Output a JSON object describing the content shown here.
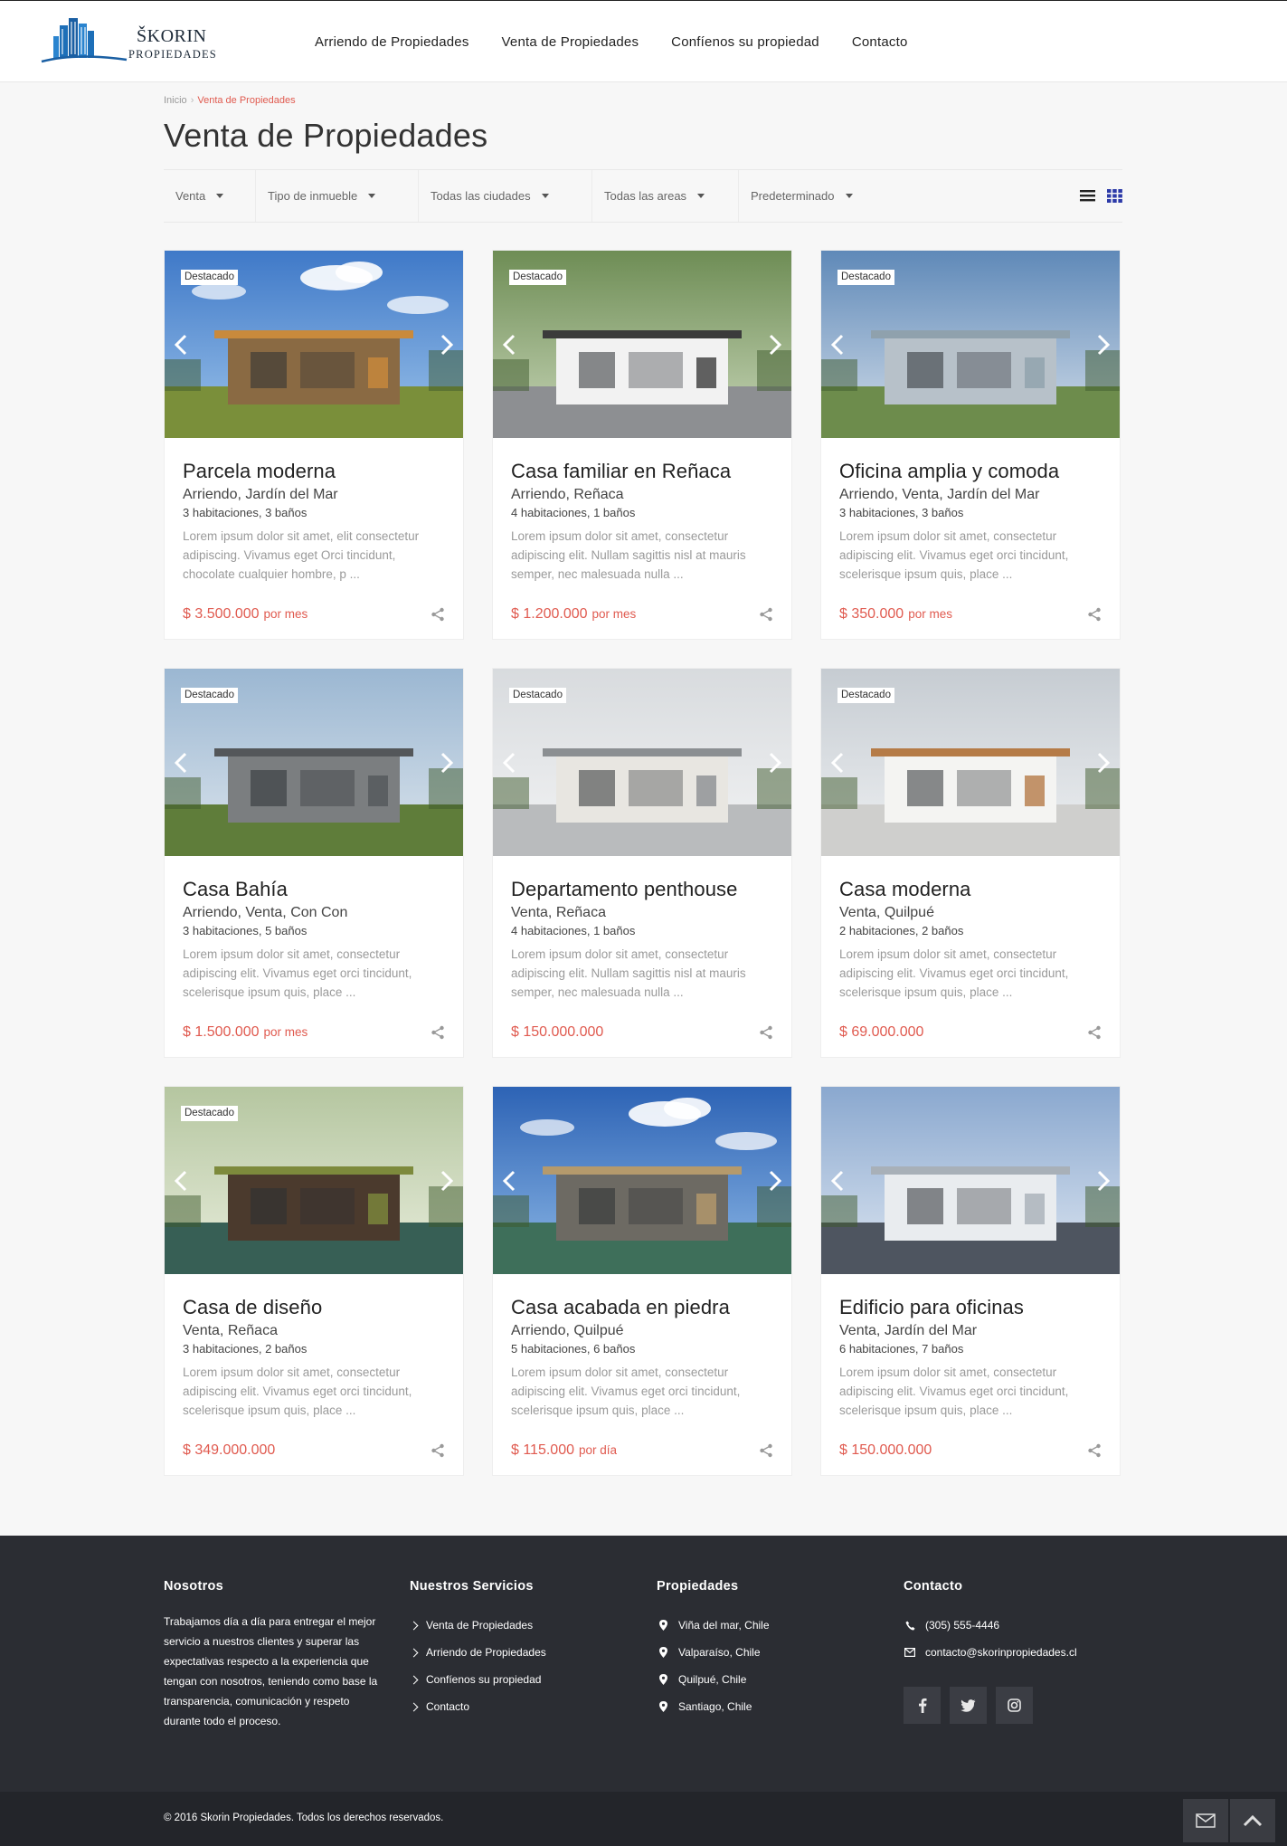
{
  "header": {
    "logo_name": "ŠKORIN",
    "logo_sub": "PROPIEDADES",
    "nav": [
      "Arriendo de Propiedades",
      "Venta de Propiedades",
      "Confíenos su propiedad",
      "Contacto"
    ]
  },
  "breadcrumb": {
    "home": "Inicio",
    "separator": "›",
    "current": "Venta de Propiedades"
  },
  "page_title": "Venta de Propiedades",
  "filters": {
    "status": "Venta",
    "type": "Tipo de inmueble",
    "city": "Todas las ciudades",
    "area": "Todas las areas",
    "sort": "Predeterminado"
  },
  "view_icons": [
    "list-view-icon",
    "grid-view-icon"
  ],
  "colors": {
    "accent": "#e05a4f",
    "footer": "#2b2d33",
    "logo": "#1d6fb8",
    "grid_icon": "#2c3aa8"
  },
  "featured_label": "Destacado",
  "properties": [
    {
      "title": "Parcela moderna",
      "location": "Arriendo, Jardín del Mar",
      "rooms": "3 habitaciones, 3 baños",
      "desc": "Lorem ipsum dolor sit amet, elit consectetur adipiscing. Vivamus eget Orci tincidunt, chocolate cualquier hombre, p ...",
      "price": "$ 3.500.000",
      "per": "por mes",
      "featured": true
    },
    {
      "title": "Casa familiar en Reñaca",
      "location": "Arriendo, Reñaca",
      "rooms": "4 habitaciones, 1 baños",
      "desc": "Lorem ipsum dolor sit amet, consectetur adipiscing elit. Nullam sagittis nisl at mauris semper, nec malesuada nulla ...",
      "price": "$ 1.200.000",
      "per": "por mes",
      "featured": true
    },
    {
      "title": "Oficina amplia y comoda",
      "location": "Arriendo, Venta, Jardín del Mar",
      "rooms": "3 habitaciones, 3 baños",
      "desc": "Lorem ipsum dolor sit amet, consectetur adipiscing elit. Vivamus eget orci tincidunt, scelerisque ipsum quis, place ...",
      "price": "$ 350.000",
      "per": "por mes",
      "featured": true
    },
    {
      "title": "Casa Bahía",
      "location": "Arriendo, Venta, Con Con",
      "rooms": "3 habitaciones, 5 baños",
      "desc": "Lorem ipsum dolor sit amet, consectetur adipiscing elit. Vivamus eget orci tincidunt, scelerisque ipsum quis, place ...",
      "price": "$ 1.500.000",
      "per": "por mes",
      "featured": true
    },
    {
      "title": "Departamento penthouse",
      "location": "Venta, Reñaca",
      "rooms": "4 habitaciones, 1 baños",
      "desc": "Lorem ipsum dolor sit amet, consectetur adipiscing elit. Nullam sagittis nisl at mauris semper, nec malesuada nulla ...",
      "price": "$ 150.000.000",
      "per": "",
      "featured": true
    },
    {
      "title": "Casa moderna",
      "location": "Venta, Quilpué",
      "rooms": "2 habitaciones, 2 baños",
      "desc": "Lorem ipsum dolor sit amet, consectetur adipiscing elit. Vivamus eget orci tincidunt, scelerisque ipsum quis, place ...",
      "price": "$ 69.000.000",
      "per": "",
      "featured": true
    },
    {
      "title": "Casa de diseño",
      "location": "Venta, Reñaca",
      "rooms": "3 habitaciones, 2 baños",
      "desc": "Lorem ipsum dolor sit amet, consectetur adipiscing elit. Vivamus eget orci tincidunt, scelerisque ipsum quis, place ...",
      "price": "$ 349.000.000",
      "per": "",
      "featured": true
    },
    {
      "title": "Casa acabada en piedra",
      "location": "Arriendo, Quilpué",
      "rooms": "5 habitaciones, 6 baños",
      "desc": "Lorem ipsum dolor sit amet, consectetur adipiscing elit. Vivamus eget orci tincidunt, scelerisque ipsum quis, place ...",
      "price": "$ 115.000",
      "per": "por día",
      "featured": false
    },
    {
      "title": "Edificio para oficinas",
      "location": "Venta, Jardín del Mar",
      "rooms": "6 habitaciones, 7 baños",
      "desc": "Lorem ipsum dolor sit amet, consectetur adipiscing elit. Vivamus eget orci tincidunt, scelerisque ipsum quis, place ...",
      "price": "$ 150.000.000",
      "per": "",
      "featured": false
    }
  ],
  "footer": {
    "about_title": "Nosotros",
    "about_text": "Trabajamos día a día para entregar el mejor servicio a nuestros clientes y superar las expectativas respecto a la experiencia que tengan con nosotros, teniendo como base la transparencia, comunicación y respeto durante todo el proceso.",
    "services_title": "Nuestros Servicios",
    "services": [
      "Venta de Propiedades",
      "Arriendo de Propiedades",
      "Confíenos su propiedad",
      "Contacto"
    ],
    "props_title": "Propiedades",
    "places": [
      "Viña del mar, Chile",
      "Valparaíso, Chile",
      "Quilpué, Chile",
      "Santiago, Chile"
    ],
    "contact_title": "Contacto",
    "phone": "(305) 555-4446",
    "email": "contacto@skorinpropiedades.cl",
    "social_icons": [
      "facebook-icon",
      "twitter-icon",
      "instagram-icon"
    ],
    "copyright": "© 2016 Skorin Propiedades. Todos los derechos reservados."
  }
}
